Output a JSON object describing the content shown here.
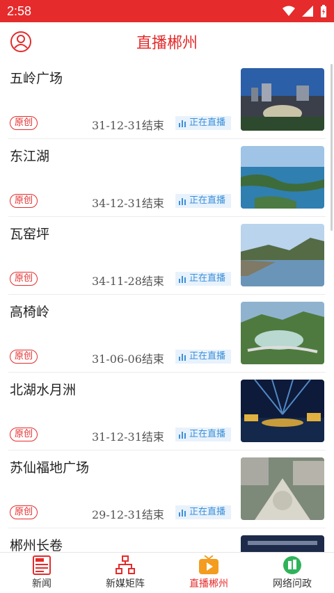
{
  "status": {
    "time": "2:58"
  },
  "header": {
    "title": "直播郴州"
  },
  "list": {
    "items": [
      {
        "name": "五岭广场",
        "badge": "原创",
        "end": "31-12-31结束",
        "live": "正在直播"
      },
      {
        "name": "东江湖",
        "badge": "原创",
        "end": "34-12-31结束",
        "live": "正在直播"
      },
      {
        "name": "瓦窑坪",
        "badge": "原创",
        "end": "34-11-28结束",
        "live": "正在直播"
      },
      {
        "name": "高椅岭",
        "badge": "原创",
        "end": "31-06-06结束",
        "live": "正在直播"
      },
      {
        "name": "北湖水月洲",
        "badge": "原创",
        "end": "31-12-31结束",
        "live": "正在直播"
      },
      {
        "name": "苏仙福地广场",
        "badge": "原创",
        "end": "29-12-31结束",
        "live": "正在直播"
      },
      {
        "name": "郴州长卷"
      }
    ]
  },
  "nav": {
    "tabs": [
      {
        "label": "新闻",
        "icon": "news-icon"
      },
      {
        "label": "新媒矩阵",
        "icon": "matrix-icon"
      },
      {
        "label": "直播郴州",
        "icon": "live-play-icon"
      },
      {
        "label": "网络问政",
        "icon": "inquiry-icon"
      }
    ]
  },
  "colors": {
    "accent": "#e52b2b",
    "live_text": "#3a8fd8",
    "live_bg": "#e8f2fc"
  }
}
